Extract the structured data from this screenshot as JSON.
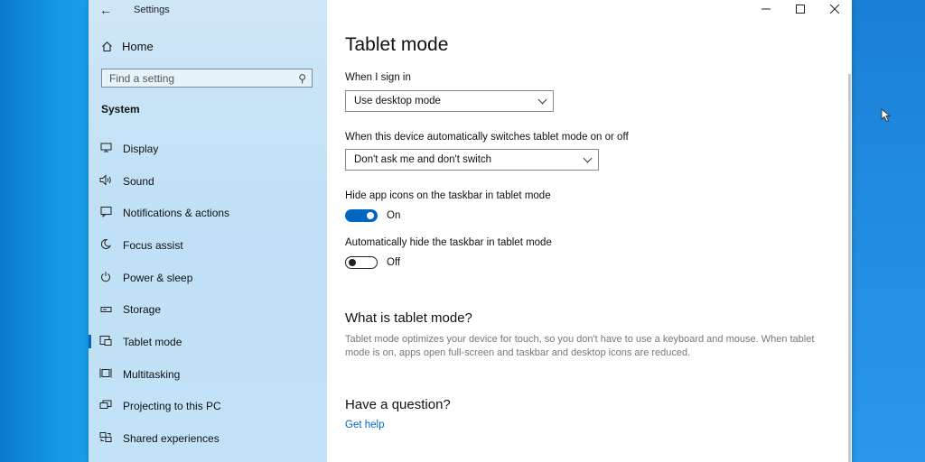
{
  "window": {
    "title": "Settings",
    "back_icon": "back-arrow-icon"
  },
  "sidebar": {
    "home_label": "Home",
    "search_placeholder": "Find a setting",
    "section_title": "System",
    "items": [
      {
        "label": "Display",
        "icon": "display-icon"
      },
      {
        "label": "Sound",
        "icon": "sound-icon"
      },
      {
        "label": "Notifications & actions",
        "icon": "notifications-icon"
      },
      {
        "label": "Focus assist",
        "icon": "focus-assist-icon"
      },
      {
        "label": "Power & sleep",
        "icon": "power-icon"
      },
      {
        "label": "Storage",
        "icon": "storage-icon"
      },
      {
        "label": "Tablet mode",
        "icon": "tablet-mode-icon",
        "active": true
      },
      {
        "label": "Multitasking",
        "icon": "multitasking-icon"
      },
      {
        "label": "Projecting to this PC",
        "icon": "projecting-icon"
      },
      {
        "label": "Shared experiences",
        "icon": "shared-experiences-icon"
      }
    ]
  },
  "content": {
    "title": "Tablet mode",
    "sign_in_label": "When I sign in",
    "sign_in_value": "Use desktop mode",
    "auto_switch_label": "When this device automatically switches tablet mode on or off",
    "auto_switch_value": "Don't ask me and don't switch",
    "hide_icons_label": "Hide app icons on the taskbar in tablet mode",
    "hide_icons_state": "On",
    "hide_taskbar_label": "Automatically hide the taskbar in tablet mode",
    "hide_taskbar_state": "Off",
    "what_is_heading": "What is tablet mode?",
    "what_is_text": "Tablet mode optimizes your device for touch, so you don't have to use a keyboard and mouse. When tablet mode is on, apps open full-screen and taskbar and desktop icons are reduced.",
    "question_heading": "Have a question?",
    "help_link": "Get help"
  },
  "colors": {
    "accent": "#0067c0",
    "sidebar_bg": "#c7e3f7",
    "desktop": "#1c9ee8"
  }
}
